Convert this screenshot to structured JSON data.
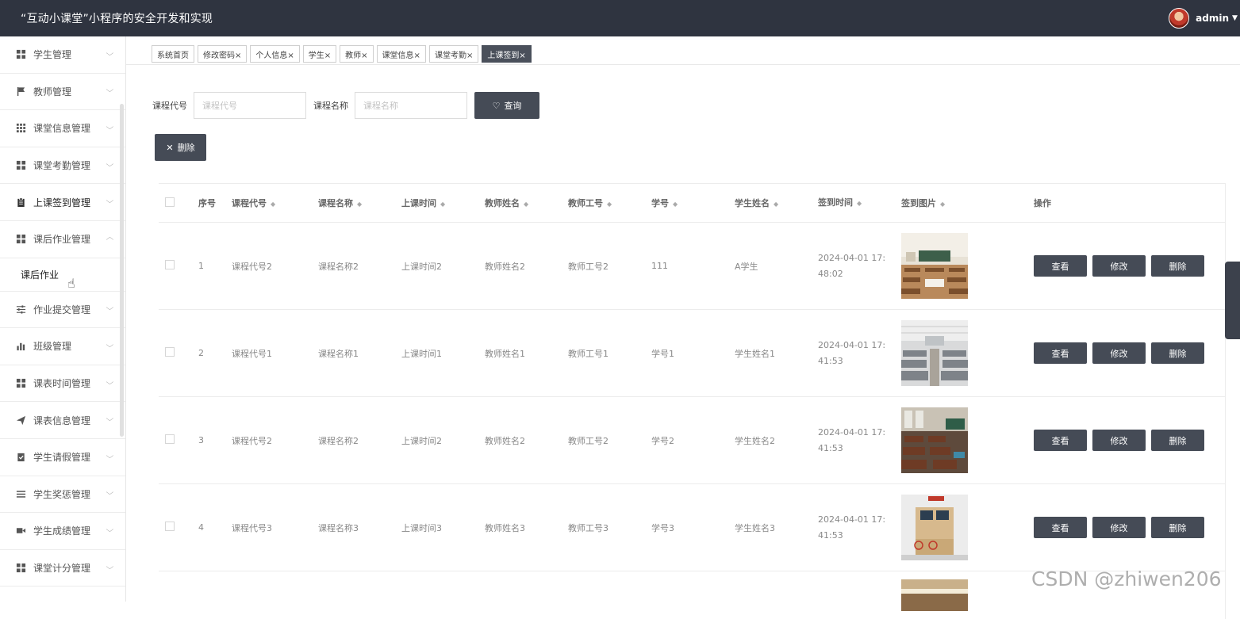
{
  "header": {
    "title": "“互动小课堂”小程序的安全开发和实现",
    "username": "admin",
    "caret": "▼"
  },
  "sidebar": {
    "items": [
      {
        "label": "学生管理",
        "icon": "grid-icon"
      },
      {
        "label": "教师管理",
        "icon": "flag-icon"
      },
      {
        "label": "课堂信息管理",
        "icon": "grid-dots-icon"
      },
      {
        "label": "课堂考勤管理",
        "icon": "grid-icon"
      },
      {
        "label": "上课签到管理",
        "icon": "clipboard-icon"
      },
      {
        "label": "课后作业管理",
        "icon": "grid-icon",
        "expanded": true
      }
    ],
    "submenu": {
      "label": "课后作业"
    },
    "items_after": [
      {
        "label": "作业提交管理",
        "icon": "sliders-icon"
      },
      {
        "label": "班级管理",
        "icon": "bar-chart-icon"
      },
      {
        "label": "课表时间管理",
        "icon": "grid-icon"
      },
      {
        "label": "课表信息管理",
        "icon": "send-icon"
      },
      {
        "label": "学生请假管理",
        "icon": "clipboard-check-icon"
      },
      {
        "label": "学生奖惩管理",
        "icon": "list-icon"
      },
      {
        "label": "学生成绩管理",
        "icon": "video-icon"
      },
      {
        "label": "课堂计分管理",
        "icon": "grid-icon"
      }
    ]
  },
  "tabs": [
    "系统首页",
    "修改密码×",
    "个人信息×",
    "学生×",
    "教师×",
    "课堂信息×",
    "课堂考勤×",
    "上课签到×"
  ],
  "search": {
    "course_code_label": "课程代号",
    "course_code_placeholder": "课程代号",
    "course_name_label": "课程名称",
    "course_name_placeholder": "课程名称",
    "query_label": "查询",
    "query_icon": "♡"
  },
  "toolbar": {
    "delete_label": "删除",
    "delete_icon": "✕"
  },
  "table": {
    "headers": {
      "index": "序号",
      "course_code": "课程代号",
      "course_name": "课程名称",
      "class_time": "上课时间",
      "teacher_name": "教师姓名",
      "teacher_no": "教师工号",
      "student_no": "学号",
      "student_name": "学生姓名",
      "sign_time": "签到时间",
      "sign_image": "签到图片",
      "actions": "操作"
    },
    "sort_glyph": "◆",
    "rows": [
      {
        "index": "1",
        "course_code": "课程代号2",
        "course_name": "课程名称2",
        "class_time": "上课时间2",
        "teacher_name": "教师姓名2",
        "teacher_no": "教师工号2",
        "student_no": "111",
        "student_name": "A学生",
        "sign_time_1": "2024-04-01 17:",
        "sign_time_2": "48:02",
        "image": "classroom-photo"
      },
      {
        "index": "2",
        "course_code": "课程代号1",
        "course_name": "课程名称1",
        "class_time": "上课时间1",
        "teacher_name": "教师姓名1",
        "teacher_no": "教师工号1",
        "student_no": "学号1",
        "student_name": "学生姓名1",
        "sign_time_1": "2024-04-01 17:",
        "sign_time_2": "41:53",
        "image": "lecture-hall-photo"
      },
      {
        "index": "3",
        "course_code": "课程代号2",
        "course_name": "课程名称2",
        "class_time": "上课时间2",
        "teacher_name": "教师姓名2",
        "teacher_no": "教师工号2",
        "student_no": "学号2",
        "student_name": "学生姓名2",
        "sign_time_1": "2024-04-01 17:",
        "sign_time_2": "41:53",
        "image": "desks-photo"
      },
      {
        "index": "4",
        "course_code": "课程代号3",
        "course_name": "课程名称3",
        "class_time": "上课时间3",
        "teacher_name": "教师姓名3",
        "teacher_no": "教师工号3",
        "student_no": "学号3",
        "student_name": "学生姓名3",
        "sign_time_1": "2024-04-01 17:",
        "sign_time_2": "41:53",
        "image": "computer-desk-photo"
      }
    ],
    "actions": {
      "view": "查看",
      "edit": "修改",
      "delete": "删除"
    }
  },
  "watermark": "CSDN @zhiwen206"
}
